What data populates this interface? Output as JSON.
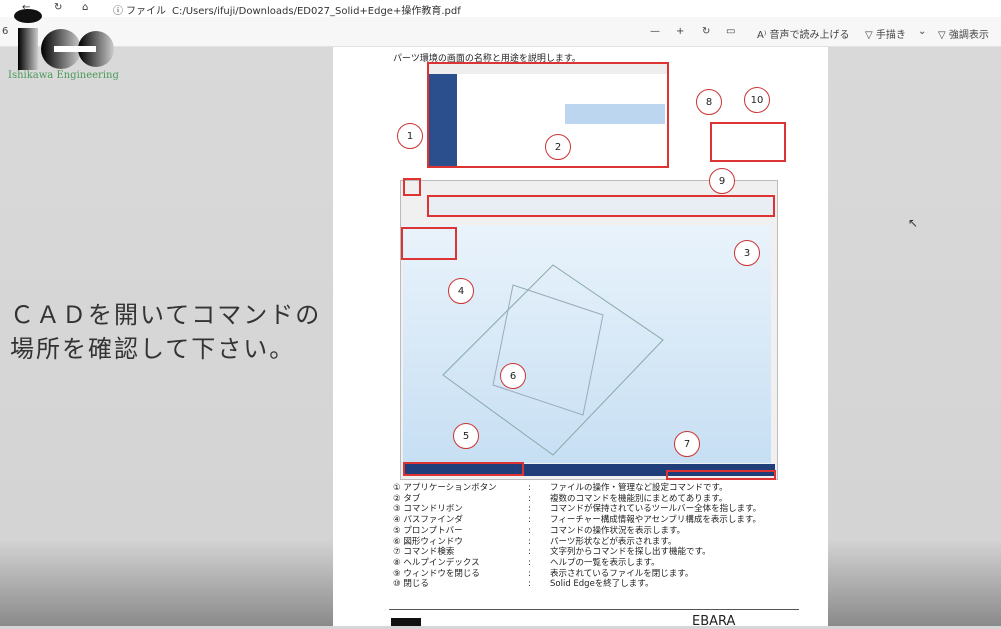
{
  "browser": {
    "address_prefix": "ファイル",
    "url": "C:/Users/ifuji/Downloads/ED027_Solid+Edge+操作教育.pdf",
    "page_partial": "6"
  },
  "toolbar": {
    "zoom_out": "—",
    "zoom_in": "+",
    "read_aloud": "音声で読み上げる",
    "draw": "手描き",
    "highlight": "強調表示"
  },
  "logo": {
    "text": "Ishikawa Engineering",
    "mark": "ie"
  },
  "caption": {
    "line1": "ＣＡＤを開いてコマンドの",
    "line2": "場所を確認して下さい。"
  },
  "document": {
    "title": "パーツ環境の画面の名称と用途を説明します。",
    "callouts": [
      "1",
      "2",
      "3",
      "4",
      "5",
      "6",
      "7",
      "8",
      "9",
      "10"
    ],
    "items": [
      {
        "num": "①",
        "name": "アプリケーションボタン",
        "sep": ":",
        "desc": "ファイルの操作・管理など設定コマンドです。"
      },
      {
        "num": "②",
        "name": "タブ",
        "sep": ":",
        "desc": "複数のコマンドを機能別にまとめてあります。"
      },
      {
        "num": "③",
        "name": "コマンドリボン",
        "sep": ":",
        "desc": "コマンドが保持されているツールバー全体を指します。"
      },
      {
        "num": "④",
        "name": "パスファインダ",
        "sep": ":",
        "desc": "フィーチャー構成情報やアセンブリ構成を表示します。"
      },
      {
        "num": "⑤",
        "name": "プロンプトバー",
        "sep": ":",
        "desc": "コマンドの操作状況を表示します。"
      },
      {
        "num": "⑥",
        "name": "図形ウィンドウ",
        "sep": ":",
        "desc": "パーツ形状などが表示されます。"
      },
      {
        "num": "⑦",
        "name": "コマンド検索",
        "sep": ":",
        "desc": "文字列からコマンドを探し出す機能です。"
      },
      {
        "num": "⑧",
        "name": "ヘルプインデックス",
        "sep": ":",
        "desc": "ヘルプの一覧を表示します。"
      },
      {
        "num": "⑨",
        "name": "ウィンドウを閉じる",
        "sep": ":",
        "desc": "表示されているファイルを閉じます。"
      },
      {
        "num": "⑩",
        "name": "閉じる",
        "sep": ":",
        "desc": "Solid Edgeを終了します。"
      }
    ],
    "footer_brand": "EBARA"
  }
}
